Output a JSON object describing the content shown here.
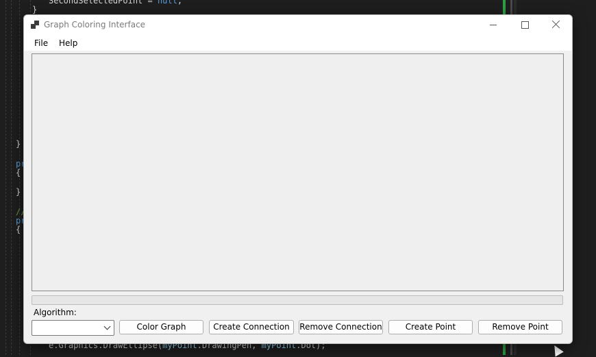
{
  "window": {
    "title": "Graph Coloring Interface"
  },
  "menu": {
    "file": "File",
    "help": "Help"
  },
  "progress": {
    "value_percent": 0,
    "fill_color": "#06b025"
  },
  "algorithm": {
    "label": "Algorithm:",
    "selected": ""
  },
  "buttons": {
    "color_graph": "Color Graph",
    "create_connection": "Create Connection",
    "remove_connection": "Remove Connection",
    "create_point": "Create Point",
    "remove_point": "Remove Point"
  },
  "background_code": {
    "line1_a": "SecondSelectedPoint = ",
    "line1_b": "null",
    "line1_c": ";",
    "line2": "}",
    "line3": "}",
    "line4": "pr",
    "line5": "{",
    "line6": "}",
    "line7": "//",
    "line8": "pr",
    "line9": "{",
    "line10_a": "e.Graphics.DrawEllipse(",
    "line10_b": "myPoint",
    "line10_c": ".DrawingPen, ",
    "line10_d": "myPoint",
    "line10_e": ".Dot);"
  },
  "colors": {
    "editor_background": "#1e1e1e",
    "window_background": "#f0f0f0",
    "keyword": "#569cd6"
  }
}
